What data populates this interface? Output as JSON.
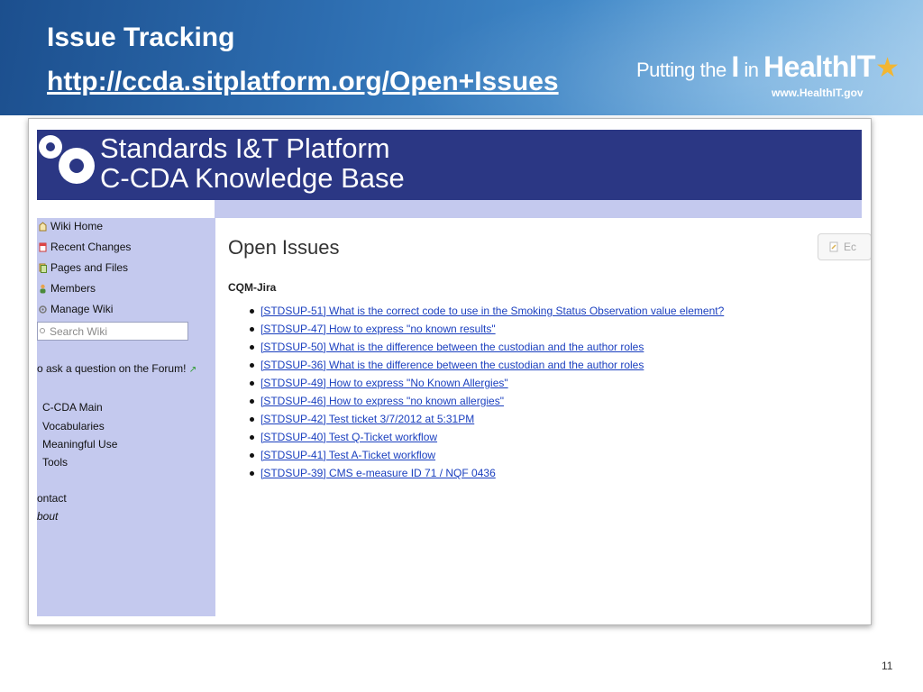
{
  "slide": {
    "title": "Issue Tracking",
    "link": "http://ccda.sitplatform.org/Open+Issues",
    "page_number": "11"
  },
  "brand": {
    "prefix": "Putting the ",
    "letter_i": "I",
    "in": " in ",
    "health": "Health",
    "it": "IT",
    "star": "★",
    "url": "www.HealthIT.gov"
  },
  "wiki": {
    "logo_line1": "Standards I&T Platform",
    "logo_line2": "C-CDA Knowledge Base",
    "sidebar": {
      "items": [
        {
          "label": "Wiki Home",
          "icon": "home-icon"
        },
        {
          "label": "Recent Changes",
          "icon": "recent-changes-icon"
        },
        {
          "label": "Pages and Files",
          "icon": "pages-icon"
        },
        {
          "label": "Members",
          "icon": "members-icon"
        },
        {
          "label": "Manage Wiki",
          "icon": "manage-icon"
        }
      ],
      "search_placeholder": "Search Wiki",
      "forum_text": "o ask a question on the Forum!",
      "nav": [
        "C-CDA Main",
        "Vocabularies",
        "Meaningful Use",
        "Tools"
      ],
      "footer_links": [
        "ontact",
        "bout"
      ]
    },
    "main": {
      "title": "Open Issues",
      "edit_label": "Ec",
      "section_label": "CQM-Jira",
      "issues": [
        "[STDSUP-51] What is the correct code to use in the Smoking Status Observation value element?",
        "[STDSUP-47] How to express \"no known results\"",
        "[STDSUP-50] What is the difference between the custodian and the author roles",
        "[STDSUP-36] What is the difference between the custodian and the author roles",
        "[STDSUP-49] How to express \"No Known Allergies\"",
        "[STDSUP-46] How to express \"no known allergies\"",
        "[STDSUP-42] Test ticket 3/7/2012 at 5:31PM",
        "[STDSUP-40] Test Q-Ticket workflow",
        "[STDSUP-41] Test A-Ticket workflow",
        "[STDSUP-39] CMS e-measure ID 71 / NQF 0436"
      ]
    }
  },
  "colors": {
    "header_blue": "#1c4f8e",
    "wiki_banner": "#2b3784",
    "sidebar_bg": "#c4c9ee",
    "link_blue": "#1a3fbf",
    "star_gold": "#f2b632"
  }
}
